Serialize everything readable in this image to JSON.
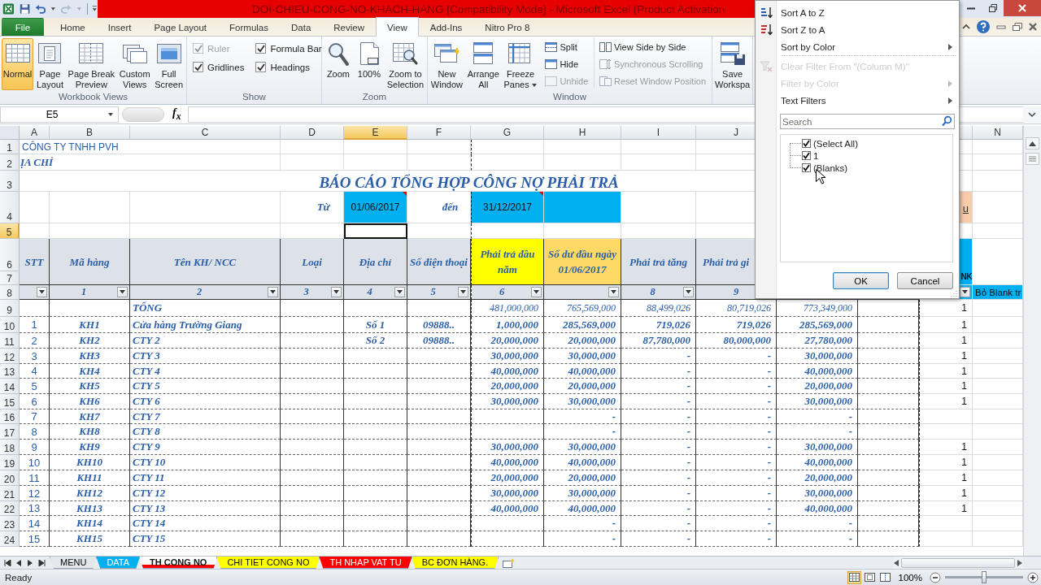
{
  "window": {
    "title": "DOI-CHIEU-CONG-NO-KHACH-HANG  [Compatibility Mode]  -  Microsoft Excel (Product Activation"
  },
  "quick_access": [
    {
      "disabled": false
    },
    {
      "disabled": false
    },
    {
      "disabled": true
    }
  ],
  "ribbon_tabs": [
    {
      "label": "File",
      "kind": "file",
      "selected": false
    },
    {
      "label": "Home",
      "kind": "tab",
      "selected": false
    },
    {
      "label": "Insert",
      "kind": "tab",
      "selected": false
    },
    {
      "label": "Page Layout",
      "kind": "tab",
      "selected": false
    },
    {
      "label": "Formulas",
      "kind": "tab",
      "selected": false
    },
    {
      "label": "Data",
      "kind": "tab",
      "selected": false
    },
    {
      "label": "Review",
      "kind": "tab",
      "selected": false
    },
    {
      "label": "View",
      "kind": "tab",
      "selected": true
    },
    {
      "label": "Add-Ins",
      "kind": "tab",
      "selected": false
    },
    {
      "label": "Nitro Pro 8",
      "kind": "tab",
      "selected": false
    }
  ],
  "ribbon": {
    "groups": [
      {
        "label": "Workbook Views",
        "items": [
          {
            "kind": "large",
            "label": "Normal",
            "selected": true
          },
          {
            "kind": "large",
            "label": "Page\nLayout",
            "selected": false
          },
          {
            "kind": "large",
            "label": "Page Break\nPreview",
            "selected": false
          },
          {
            "kind": "large",
            "label": "Custom\nViews",
            "selected": false
          },
          {
            "kind": "large",
            "label": "Full\nScreen",
            "selected": false
          }
        ]
      },
      {
        "label": "Show",
        "items": [
          {
            "kind": "checkbox",
            "label": "Ruler",
            "checked": true,
            "disabled": true
          },
          {
            "kind": "checkbox",
            "label": "Formula Bar",
            "checked": true,
            "disabled": false
          },
          {
            "kind": "checkbox",
            "label": "Gridlines",
            "checked": true,
            "disabled": false
          },
          {
            "kind": "checkbox",
            "label": "Headings",
            "checked": true,
            "disabled": false
          }
        ]
      },
      {
        "label": "Zoom",
        "items": [
          {
            "kind": "large",
            "label": "Zoom"
          },
          {
            "kind": "large",
            "label": "100%"
          },
          {
            "kind": "large",
            "label": "Zoom to\nSelection"
          }
        ]
      },
      {
        "label": "Window",
        "items": [
          {
            "kind": "large",
            "label": "New\nWindow"
          },
          {
            "kind": "large",
            "label": "Arrange\nAll"
          },
          {
            "kind": "large",
            "label": "Freeze\nPanes",
            "dropdown": true
          },
          {
            "kind": "small",
            "label": "Split",
            "disabled": false
          },
          {
            "kind": "small",
            "label": "Hide",
            "disabled": false
          },
          {
            "kind": "small",
            "label": "Unhide",
            "disabled": true
          },
          {
            "kind": "small",
            "label": "View Side by Side",
            "disabled": false
          },
          {
            "kind": "small",
            "label": "Synchronous Scrolling",
            "disabled": true
          },
          {
            "kind": "small",
            "label": "Reset Window Position",
            "disabled": true
          }
        ]
      },
      {
        "items": [
          {
            "kind": "large",
            "label": "Save\nWorkspa"
          }
        ]
      }
    ]
  },
  "formula_bar": {
    "name_box": "E5",
    "function_label": "f$_{x}$"
  },
  "sheet": {
    "columns": [
      {
        "label": "A",
        "selected": false
      },
      {
        "label": "B",
        "selected": false
      },
      {
        "label": "C",
        "selected": false
      },
      {
        "label": "D",
        "selected": false
      },
      {
        "label": "E",
        "selected": true
      },
      {
        "label": "F",
        "selected": false
      },
      {
        "label": "G",
        "selected": false
      },
      {
        "label": "H",
        "selected": false
      },
      {
        "label": "I",
        "selected": false
      },
      {
        "label": "J",
        "selected": false
      },
      {},
      {},
      {},
      {
        "label": "N",
        "selected": false
      }
    ],
    "rows": [
      {
        "label": "1",
        "kind": "plain",
        "selected": false,
        "cells": {
          "A": {
            "text": "CÔNG TY TNHH PVH",
            "kind": "company"
          }
        }
      },
      {
        "label": "2",
        "kind": "plain",
        "selected": false,
        "cells": {
          "A": {
            "text": "ỊA CHỈ",
            "kind": "address"
          }
        }
      },
      {
        "label": "3",
        "kind": "plain",
        "selected": false,
        "cells": {
          "A": {
            "text": "BÁO CÁO TỔNG HỢP CÔNG NỢ PHẢI TRẢ",
            "kind": "title"
          }
        }
      },
      {
        "label": "4",
        "kind": "plain",
        "selected": false,
        "cells": {
          "D": {
            "text": "Từ",
            "kind": "label"
          },
          "E": {
            "text": "01/06/2017",
            "kind": "date",
            "color": "#00b0f0",
            "comment": true
          },
          "F": {
            "text": "đến",
            "kind": "label"
          },
          "G": {
            "text": "31/12/2017",
            "kind": "date",
            "color": "#00b0f0",
            "comment": true
          },
          "H": {
            "kind": "fill",
            "color": "#00b0f0"
          },
          "M": {
            "text": "u",
            "kind": "note",
            "color": "#f8cbad"
          }
        }
      },
      {
        "label": "5",
        "kind": "plain",
        "selected": true,
        "cells": {
          "E": {
            "active": true
          }
        }
      },
      {
        "label": "6",
        "kind": "header",
        "selected": false,
        "cells": {
          "A": {
            "text": "STT",
            "kind": "header"
          },
          "B": {
            "text": "Mã hàng",
            "kind": "header"
          },
          "C": {
            "text": "Tên KH/ NCC",
            "kind": "header"
          },
          "D": {
            "text": "Loại",
            "kind": "header"
          },
          "E": {
            "text": "Địa chỉ",
            "kind": "header"
          },
          "F": {
            "text": "Số điện thoại",
            "kind": "header"
          },
          "G": {
            "text": "Phải trả đầu năm",
            "kind": "header",
            "color": "#ffff00"
          },
          "H": {
            "text": "Số dư đầu ngày 01/06/2017",
            "kind": "header",
            "color": "#ffd966"
          },
          "I": {
            "text": "Phải trả tăng",
            "kind": "header"
          },
          "J": {
            "text": "Phải trả gi",
            "kind": "header-cut"
          },
          "M": {
            "text": "NK",
            "kind": "header-note",
            "color": "#00b0f0"
          }
        }
      },
      {
        "label": "7",
        "kind": "continuation",
        "selected": false
      },
      {
        "label": "8",
        "kind": "header",
        "selected": false,
        "cells": {
          "A": {
            "filter": true
          },
          "B": {
            "text": "1",
            "kind": "col-number",
            "filter": true
          },
          "C": {
            "text": "2",
            "kind": "col-number",
            "filter": true
          },
          "D": {
            "text": "3",
            "kind": "col-number",
            "filter": true
          },
          "E": {
            "text": "4",
            "kind": "col-number",
            "filter": true
          },
          "F": {
            "text": "5",
            "kind": "col-number",
            "filter": true
          },
          "G": {
            "text": "6",
            "kind": "col-number",
            "filter": true
          },
          "H": {
            "filter": true
          },
          "I": {
            "text": "8",
            "kind": "col-number",
            "filter": true
          },
          "J": {
            "text": "9",
            "kind": "col-number"
          },
          "M": {
            "filter": true,
            "color": "#00b0f0"
          },
          "N": {
            "text": "Bỏ Blank tr",
            "kind": "note-wide",
            "color": "#00b0f0"
          }
        }
      },
      {
        "label": "9",
        "kind": "body",
        "selected": false,
        "cells": {
          "C": {
            "text": "TỔNG",
            "kind": "total-label"
          },
          "G": {
            "text": "481,000,000",
            "kind": "total"
          },
          "H": {
            "text": "765,569,000",
            "kind": "total"
          },
          "I": {
            "text": "88,499,026",
            "kind": "total"
          },
          "J": {
            "text": "80,719,026",
            "kind": "total"
          },
          "K": {
            "text": "773,349,000",
            "kind": "total"
          },
          "M": {
            "text": "1",
            "kind": "count"
          }
        }
      },
      {
        "label": "10",
        "kind": "body",
        "selected": false,
        "cells": {
          "A": {
            "text": "1",
            "kind": "index"
          },
          "B": {
            "text": "KH1",
            "kind": "code"
          },
          "C": {
            "text": "Cửa hàng Trường Giang",
            "kind": "name"
          },
          "E": {
            "text": "Số 1",
            "kind": "code"
          },
          "F": {
            "text": "09888..",
            "kind": "code"
          },
          "G": {
            "text": "1,000,000",
            "kind": "money"
          },
          "H": {
            "text": "285,569,000",
            "kind": "money"
          },
          "I": {
            "text": "719,026",
            "kind": "money"
          },
          "J": {
            "text": "719,026",
            "kind": "money"
          },
          "K": {
            "text": "285,569,000",
            "kind": "money"
          },
          "M": {
            "text": "1",
            "kind": "count"
          }
        }
      },
      {
        "label": "11",
        "kind": "body",
        "selected": false,
        "cells": {
          "A": {
            "text": "2",
            "kind": "index"
          },
          "B": {
            "text": "KH2",
            "kind": "code"
          },
          "C": {
            "text": "CTY 2",
            "kind": "name"
          },
          "E": {
            "text": "Số 2",
            "kind": "code"
          },
          "F": {
            "text": "09888..",
            "kind": "code"
          },
          "G": {
            "text": "20,000,000",
            "kind": "money"
          },
          "H": {
            "text": "20,000,000",
            "kind": "money"
          },
          "I": {
            "text": "87,780,000",
            "kind": "money"
          },
          "J": {
            "text": "80,000,000",
            "kind": "money"
          },
          "K": {
            "text": "27,780,000",
            "kind": "money"
          },
          "M": {
            "text": "1",
            "kind": "count"
          }
        }
      },
      {
        "label": "12",
        "kind": "body",
        "selected": false,
        "cells": {
          "A": {
            "text": "3",
            "kind": "index"
          },
          "B": {
            "text": "KH3",
            "kind": "code"
          },
          "C": {
            "text": "CTY 3",
            "kind": "name"
          },
          "G": {
            "text": "30,000,000",
            "kind": "money"
          },
          "H": {
            "text": "30,000,000",
            "kind": "money"
          },
          "I": {
            "text": "-",
            "kind": "money"
          },
          "J": {
            "text": "-",
            "kind": "money"
          },
          "K": {
            "text": "30,000,000",
            "kind": "money"
          },
          "M": {
            "text": "1",
            "kind": "count"
          }
        }
      },
      {
        "label": "13",
        "kind": "body",
        "selected": false,
        "cells": {
          "A": {
            "text": "4",
            "kind": "index"
          },
          "B": {
            "text": "KH4",
            "kind": "code"
          },
          "C": {
            "text": "CTY 4",
            "kind": "name"
          },
          "G": {
            "text": "40,000,000",
            "kind": "money"
          },
          "H": {
            "text": "40,000,000",
            "kind": "money"
          },
          "I": {
            "text": "-",
            "kind": "money"
          },
          "J": {
            "text": "-",
            "kind": "money"
          },
          "K": {
            "text": "40,000,000",
            "kind": "money"
          },
          "M": {
            "text": "1",
            "kind": "count"
          }
        }
      },
      {
        "label": "14",
        "kind": "body",
        "selected": false,
        "cells": {
          "A": {
            "text": "5",
            "kind": "index"
          },
          "B": {
            "text": "KH5",
            "kind": "code"
          },
          "C": {
            "text": "CTY 5",
            "kind": "name"
          },
          "G": {
            "text": "20,000,000",
            "kind": "money"
          },
          "H": {
            "text": "20,000,000",
            "kind": "money"
          },
          "I": {
            "text": "-",
            "kind": "money"
          },
          "J": {
            "text": "-",
            "kind": "money"
          },
          "K": {
            "text": "20,000,000",
            "kind": "money"
          },
          "M": {
            "text": "1",
            "kind": "count"
          }
        }
      },
      {
        "label": "15",
        "kind": "body",
        "selected": false,
        "cells": {
          "A": {
            "text": "6",
            "kind": "index"
          },
          "B": {
            "text": "KH6",
            "kind": "code"
          },
          "C": {
            "text": "CTY 6",
            "kind": "name"
          },
          "G": {
            "text": "30,000,000",
            "kind": "money"
          },
          "H": {
            "text": "30,000,000",
            "kind": "money"
          },
          "I": {
            "text": "-",
            "kind": "money"
          },
          "J": {
            "text": "-",
            "kind": "money"
          },
          "K": {
            "text": "30,000,000",
            "kind": "money"
          },
          "M": {
            "text": "1",
            "kind": "count"
          }
        }
      },
      {
        "label": "16",
        "kind": "body",
        "selected": false,
        "cells": {
          "A": {
            "text": "7",
            "kind": "index"
          },
          "B": {
            "text": "KH7",
            "kind": "code"
          },
          "C": {
            "text": "CTY 7",
            "kind": "name"
          },
          "H": {
            "text": "-",
            "kind": "money"
          },
          "I": {
            "text": "-",
            "kind": "money"
          },
          "J": {
            "text": "-",
            "kind": "money"
          },
          "K": {
            "text": "-",
            "kind": "money"
          }
        }
      },
      {
        "label": "17",
        "kind": "body",
        "selected": false,
        "cells": {
          "A": {
            "text": "8",
            "kind": "index"
          },
          "B": {
            "text": "KH8",
            "kind": "code"
          },
          "C": {
            "text": "CTY 8",
            "kind": "name"
          },
          "H": {
            "text": "-",
            "kind": "money"
          },
          "I": {
            "text": "-",
            "kind": "money"
          },
          "J": {
            "text": "-",
            "kind": "money"
          },
          "K": {
            "text": "-",
            "kind": "money"
          }
        }
      },
      {
        "label": "18",
        "kind": "body",
        "selected": false,
        "cells": {
          "A": {
            "text": "9",
            "kind": "index"
          },
          "B": {
            "text": "KH9",
            "kind": "code"
          },
          "C": {
            "text": "CTY 9",
            "kind": "name"
          },
          "G": {
            "text": "30,000,000",
            "kind": "money"
          },
          "H": {
            "text": "30,000,000",
            "kind": "money"
          },
          "I": {
            "text": "-",
            "kind": "money"
          },
          "J": {
            "text": "-",
            "kind": "money"
          },
          "K": {
            "text": "30,000,000",
            "kind": "money"
          },
          "M": {
            "text": "1",
            "kind": "count"
          }
        }
      },
      {
        "label": "19",
        "kind": "body",
        "selected": false,
        "cells": {
          "A": {
            "text": "10",
            "kind": "index"
          },
          "B": {
            "text": "KH10",
            "kind": "code"
          },
          "C": {
            "text": "CTY 10",
            "kind": "name"
          },
          "G": {
            "text": "40,000,000",
            "kind": "money"
          },
          "H": {
            "text": "40,000,000",
            "kind": "money"
          },
          "I": {
            "text": "-",
            "kind": "money"
          },
          "J": {
            "text": "-",
            "kind": "money"
          },
          "K": {
            "text": "40,000,000",
            "kind": "money"
          },
          "M": {
            "text": "1",
            "kind": "count"
          }
        }
      },
      {
        "label": "20",
        "kind": "body",
        "selected": false,
        "cells": {
          "A": {
            "text": "11",
            "kind": "index"
          },
          "B": {
            "text": "KH11",
            "kind": "code"
          },
          "C": {
            "text": "CTY 11",
            "kind": "name"
          },
          "G": {
            "text": "20,000,000",
            "kind": "money"
          },
          "H": {
            "text": "20,000,000",
            "kind": "money"
          },
          "I": {
            "text": "-",
            "kind": "money"
          },
          "J": {
            "text": "-",
            "kind": "money"
          },
          "K": {
            "text": "20,000,000",
            "kind": "money"
          },
          "M": {
            "text": "1",
            "kind": "count"
          }
        }
      },
      {
        "label": "21",
        "kind": "body",
        "selected": false,
        "cells": {
          "A": {
            "text": "12",
            "kind": "index"
          },
          "B": {
            "text": "KH12",
            "kind": "code"
          },
          "C": {
            "text": "CTY 12",
            "kind": "name"
          },
          "G": {
            "text": "30,000,000",
            "kind": "money"
          },
          "H": {
            "text": "30,000,000",
            "kind": "money"
          },
          "I": {
            "text": "-",
            "kind": "money"
          },
          "J": {
            "text": "-",
            "kind": "money"
          },
          "K": {
            "text": "30,000,000",
            "kind": "money"
          },
          "M": {
            "text": "1",
            "kind": "count"
          }
        }
      },
      {
        "label": "22",
        "kind": "body",
        "selected": false,
        "cells": {
          "A": {
            "text": "13",
            "kind": "index"
          },
          "B": {
            "text": "KH13",
            "kind": "code"
          },
          "C": {
            "text": "CTY 13",
            "kind": "name"
          },
          "G": {
            "text": "40,000,000",
            "kind": "money"
          },
          "H": {
            "text": "40,000,000",
            "kind": "money"
          },
          "I": {
            "text": "-",
            "kind": "money"
          },
          "J": {
            "text": "-",
            "kind": "money"
          },
          "K": {
            "text": "40,000,000",
            "kind": "money"
          },
          "M": {
            "text": "1",
            "kind": "count"
          }
        }
      },
      {
        "label": "23",
        "kind": "body",
        "selected": false,
        "cells": {
          "A": {
            "text": "14",
            "kind": "index"
          },
          "B": {
            "text": "KH14",
            "kind": "code"
          },
          "C": {
            "text": "CTY 14",
            "kind": "name"
          },
          "H": {
            "text": "-",
            "kind": "money"
          },
          "I": {
            "text": "-",
            "kind": "money"
          },
          "J": {
            "text": "-",
            "kind": "money"
          },
          "K": {
            "text": "-",
            "kind": "money"
          }
        }
      },
      {
        "label": "24",
        "kind": "body",
        "selected": false,
        "cells": {
          "A": {
            "text": "15",
            "kind": "index"
          },
          "B": {
            "text": "KH15",
            "kind": "code"
          },
          "C": {
            "text": "CTY 15",
            "kind": "name"
          },
          "H": {
            "text": "-",
            "kind": "money"
          },
          "I": {
            "text": "-",
            "kind": "money"
          },
          "J": {
            "text": "-",
            "kind": "money"
          },
          "K": {
            "text": "-",
            "kind": "money"
          }
        }
      }
    ]
  },
  "filter_menu": {
    "items": [
      {
        "label": "Sort A to Z",
        "kind": "sort_ascending",
        "disabled": false,
        "submenu": false
      },
      {
        "label": "Sort Z to A",
        "kind": "sort_descending",
        "disabled": false,
        "submenu": false
      },
      {
        "label": "Sort by Color",
        "kind": "plain",
        "disabled": false,
        "submenu": true
      },
      {
        "label": "Clear Filter From \"(Column M)\"",
        "kind": "clear_filter",
        "disabled": true,
        "submenu": false,
        "separator_before": true
      },
      {
        "label": "Filter by Color",
        "kind": "plain",
        "disabled": true,
        "submenu": true
      },
      {
        "label": "Text Filters",
        "kind": "plain",
        "disabled": false,
        "submenu": true
      }
    ],
    "search": {
      "placeholder": "Search"
    },
    "values": [
      {
        "label": "(Select All)",
        "checked": true
      },
      {
        "label": "1",
        "checked": true
      },
      {
        "label": "(Blanks)",
        "checked": true
      }
    ],
    "buttons": [
      {
        "label": "OK",
        "kind": "default"
      },
      {
        "label": "Cancel",
        "kind": "normal"
      }
    ]
  },
  "sheet_tabs": [
    {
      "label": "MENU",
      "selected": false
    },
    {
      "label": "DATA",
      "color": "#00b0f0",
      "selected": false
    },
    {
      "label": "TH CONG NO",
      "color": "#ff0000",
      "selected": true
    },
    {
      "label": "CHI TIET CONG NO",
      "color": "#ffff00",
      "selected": false
    },
    {
      "label": "TH NHAP VAT TU",
      "color": "#ff0000",
      "selected": false
    },
    {
      "label": "BC ĐƠN HÀNG.",
      "color": "#ffff00",
      "selected": false
    }
  ],
  "status_bar": {
    "text": "Ready",
    "views": [
      {
        "selected": true
      },
      {
        "selected": false
      },
      {
        "selected": false
      }
    ],
    "zoom": "100%",
    "zoom_slider": {
      "level": 0.5
    }
  }
}
